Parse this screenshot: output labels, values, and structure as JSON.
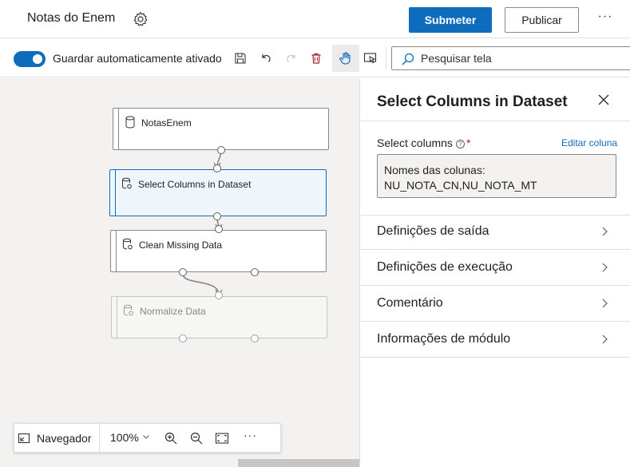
{
  "header": {
    "title": "Notas do Enem",
    "submit_label": "Submeter",
    "publish_label": "Publicar",
    "more_label": "···"
  },
  "toolbar": {
    "autosave_label": "Guardar automaticamente ativado",
    "autosave_on": true,
    "search_placeholder": "Pesquisar tela",
    "icons": [
      "save-icon",
      "undo-icon",
      "redo-icon",
      "delete-icon",
      "hand-pan-icon",
      "select-pointer-icon",
      "search-icon"
    ]
  },
  "canvas": {
    "nodes": [
      {
        "label": "NotasEnem",
        "icon": "dataset-icon",
        "state": "normal"
      },
      {
        "label": "Select Columns in Dataset",
        "icon": "module-icon",
        "state": "selected"
      },
      {
        "label": "Clean Missing Data",
        "icon": "module-icon",
        "state": "normal"
      },
      {
        "label": "Normalize Data",
        "icon": "module-icon",
        "state": "disabled"
      }
    ]
  },
  "navigator": {
    "label": "Navegador",
    "zoom": "100%",
    "more_label": "···"
  },
  "panel": {
    "title": "Select Columns in Dataset",
    "field_label": "Select columns",
    "required_mark": "*",
    "help_mark": "?",
    "edit_link": "Editar coluna",
    "columns_line1": "Nomes das colunas:",
    "columns_line2": "NU_NOTA_CN,NU_NOTA_MT",
    "sections": [
      {
        "label": "Definições de saída"
      },
      {
        "label": "Definições de execução"
      },
      {
        "label": "Comentário"
      },
      {
        "label": "Informações de módulo"
      }
    ]
  },
  "colors": {
    "accent": "#0f6cbd",
    "canvas_bg": "#f3f2f1",
    "selected_bg": "#eff6fc"
  }
}
